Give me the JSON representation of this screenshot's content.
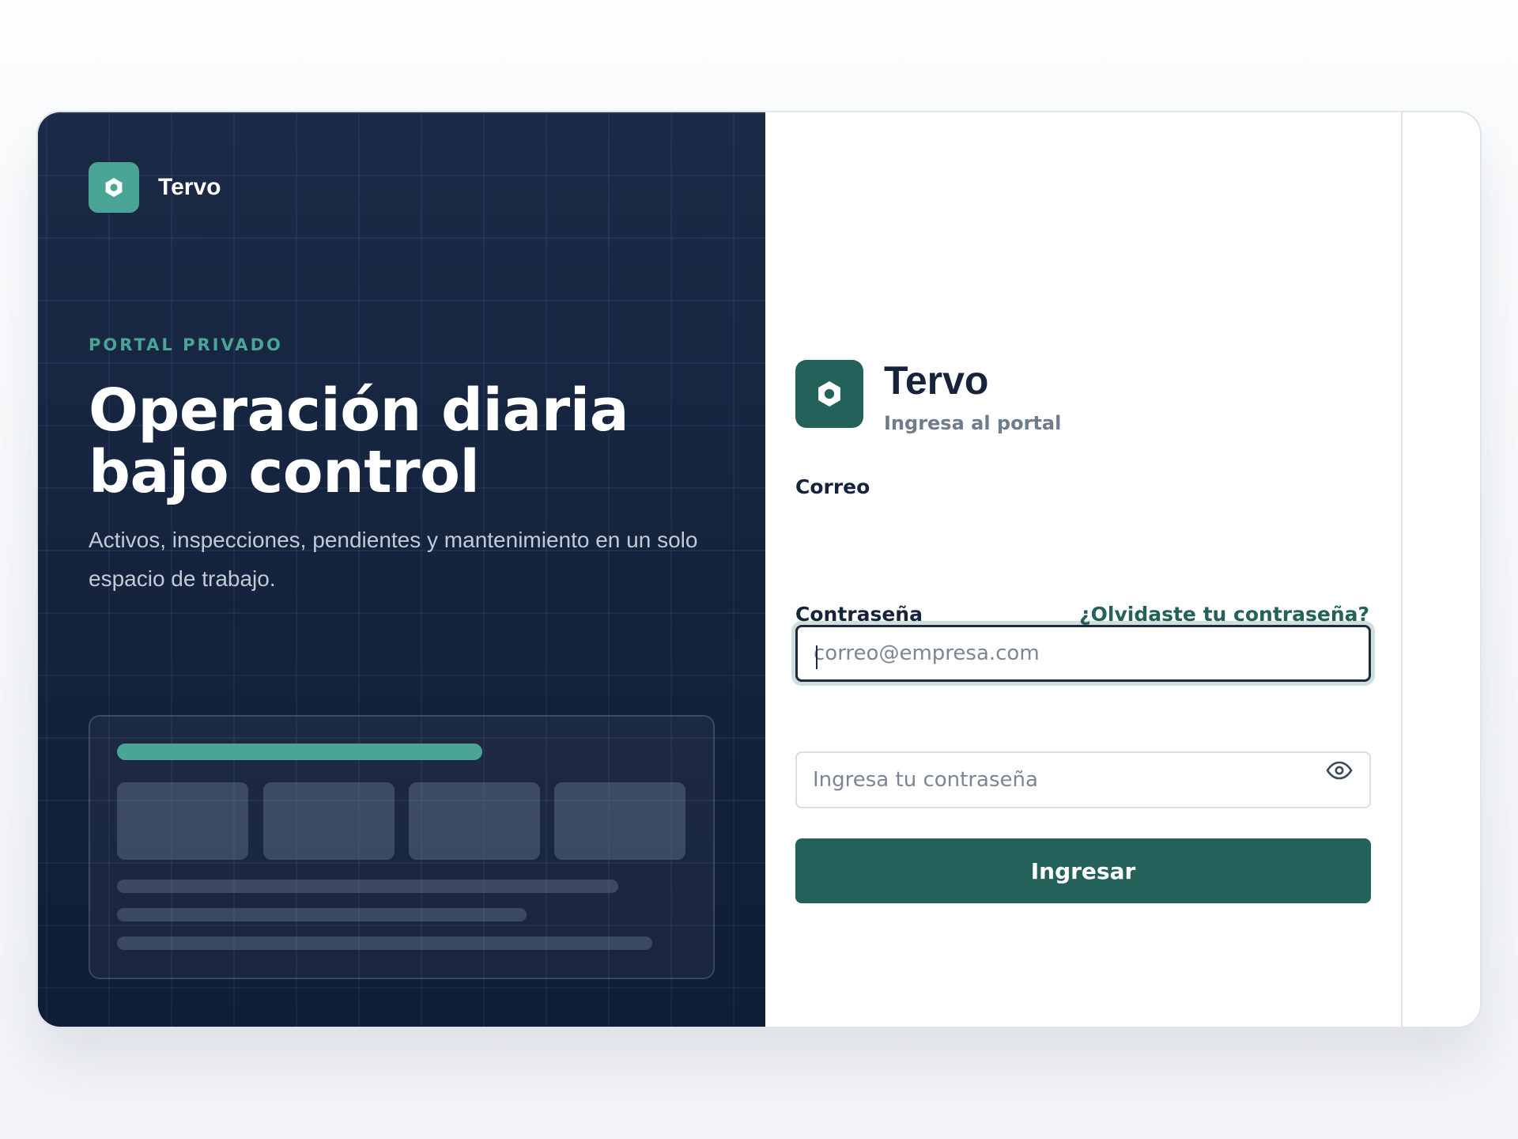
{
  "hero": {
    "brand_name": "Tervo",
    "eyebrow": "PORTAL PRIVADO",
    "title": "Operación diaria bajo control",
    "subtitle": "Activos, inspecciones, pendientes y mantenimiento en un solo espacio de trabajo.",
    "logo_icon": "hexagon-icon"
  },
  "login": {
    "brand_name": "Tervo",
    "subtitle": "Ingresa al portal",
    "logo_icon": "hexagon-icon",
    "email": {
      "label": "Correo",
      "value": "",
      "placeholder": "correo@empresa.com"
    },
    "password": {
      "label": "Contraseña",
      "value": "",
      "placeholder": "Ingresa tu contraseña",
      "toggle_icon": "eye-icon"
    },
    "forgot_label": "¿Olvidaste tu contraseña?",
    "submit_label": "Ingresar"
  },
  "colors": {
    "accent": "#23615a",
    "accent_light": "#4aa597",
    "hero_bg": "#172640",
    "text_dark": "#16233b",
    "text_muted": "#6f7c8e"
  }
}
